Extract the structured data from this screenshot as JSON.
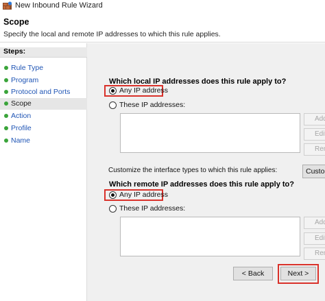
{
  "window": {
    "title": "New Inbound Rule Wizard"
  },
  "header": {
    "title": "Scope",
    "subtitle": "Specify the local and remote IP addresses to which this rule applies."
  },
  "steps": {
    "heading": "Steps:",
    "items": [
      {
        "label": "Rule Type",
        "active": false
      },
      {
        "label": "Program",
        "active": false
      },
      {
        "label": "Protocol and Ports",
        "active": false
      },
      {
        "label": "Scope",
        "active": true
      },
      {
        "label": "Action",
        "active": false
      },
      {
        "label": "Profile",
        "active": false
      },
      {
        "label": "Name",
        "active": false
      }
    ]
  },
  "local": {
    "question": "Which local IP addresses does this rule apply to?",
    "any_label": "Any IP address",
    "these_label": "These IP addresses:",
    "selected": "any",
    "buttons": {
      "add": "Add...",
      "edit": "Edit...",
      "remove": "Remove"
    }
  },
  "customize": {
    "text": "Customize the interface types to which this rule applies:",
    "button": "Customize..."
  },
  "remote": {
    "question": "Which remote IP addresses does this rule apply to?",
    "any_label": "Any IP address",
    "these_label": "These IP addresses:",
    "selected": "any",
    "buttons": {
      "add": "Add...",
      "edit": "Edit...",
      "remove": "Remove"
    }
  },
  "nav": {
    "back": "< Back",
    "next": "Next >"
  },
  "colors": {
    "highlight": "#d9312a",
    "step_dot": "#3aa43a",
    "step_link": "#1f55b5"
  }
}
